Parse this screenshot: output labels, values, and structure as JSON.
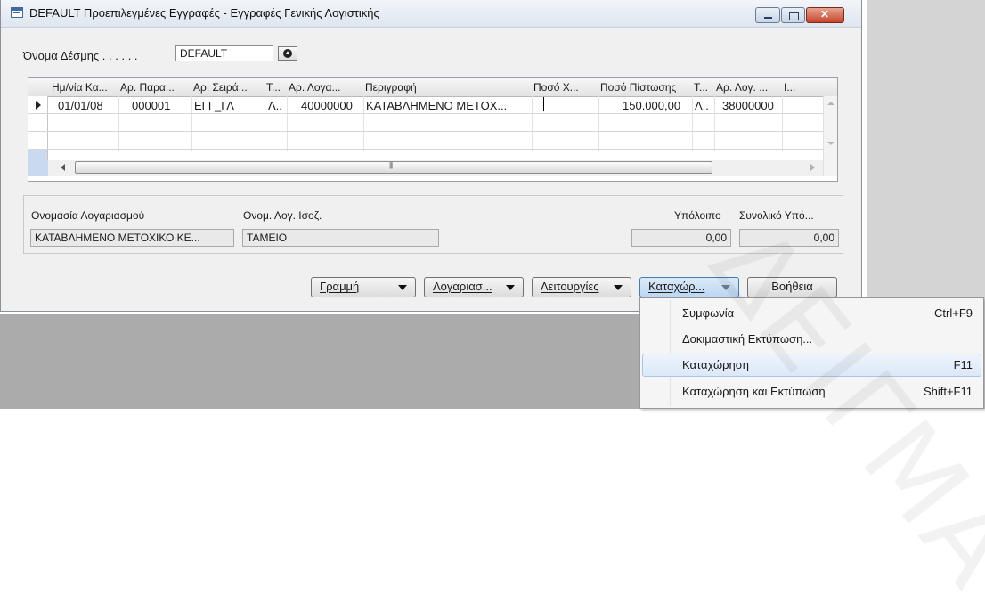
{
  "window": {
    "title": "DEFAULT Προεπιλεγμένες Εγγραφές - Εγγραφές Γενικής Λογιστικής"
  },
  "batch": {
    "label": "Όνομα Δέσμης . . . . . .",
    "value": "DEFAULT"
  },
  "grid": {
    "columns": [
      "Ημ/νία Κα...",
      "Αρ. Παρα...",
      "Αρ. Σειρά...",
      "Τ...",
      "Αρ. Λογα...",
      "Περιγραφή",
      "Ποσό Χ...",
      "Ποσό Πίστωσης",
      "Τ...",
      "Αρ. Λογ. ...",
      "Ι..."
    ],
    "rows": [
      {
        "date": "01/01/08",
        "doc_no": "000001",
        "series": "ΕΓΓ_ΓΛ",
        "type": "Λ..",
        "account": "40000000",
        "description": "ΚΑΤΑΒΛΗΜΕΝΟ ΜΕΤΟΧ...",
        "debit": "",
        "credit": "150.000,00",
        "bal_type": "Λ..",
        "bal_account": "38000000"
      }
    ]
  },
  "info": {
    "account_name_label": "Ονομασία Λογαριασμού",
    "account_name_value": "ΚΑΤΑΒΛΗΜΕΝΟ ΜΕΤΟΧΙΚΟ ΚΕ...",
    "balance_account_label": "Ονομ. Λογ. Ισοζ.",
    "balance_account_value": "ΤΑΜΕΙΟ",
    "balance_label": "Υπόλοιπο",
    "balance_value": "0,00",
    "total_balance_label": "Συνολικό Υπό...",
    "total_balance_value": "0,00"
  },
  "buttons": {
    "line": "Γραμμή",
    "account": "Λογαριασ...",
    "functions": "Λειτουργίες",
    "post": "Καταχώρ...",
    "help": "Βοήθεια"
  },
  "menu": {
    "items": [
      {
        "label": "Συμφωνία",
        "shortcut": "Ctrl+F9"
      },
      {
        "label": "Δοκιμαστική Εκτύπωση...",
        "shortcut": ""
      },
      {
        "label": "Καταχώρηση",
        "shortcut": "F11"
      },
      {
        "label": "Καταχώρηση και Εκτύπωση",
        "shortcut": "Shift+F11"
      }
    ]
  },
  "watermark": "ΔΕΙΓΜΑ",
  "colors": {
    "menu_highlight": "#dce8f8",
    "close_button": "#c7452a",
    "row_selector_blue": "#c9daf0"
  }
}
